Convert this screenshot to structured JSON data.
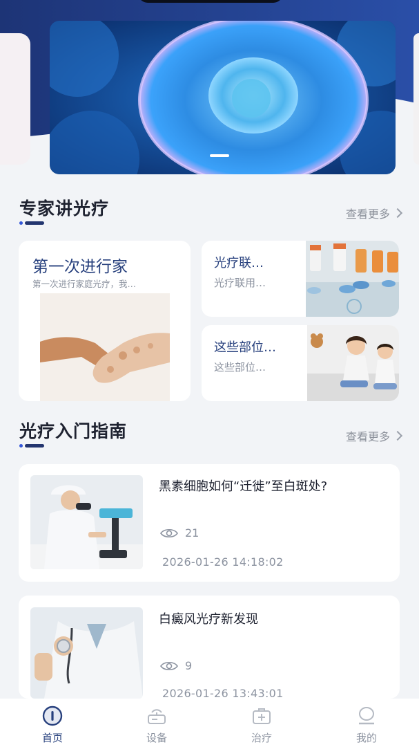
{
  "expert_section": {
    "title": "专家讲光疗",
    "more": "查看更多",
    "cards": [
      {
        "title": "第一次进行家",
        "subtitle": "第一次进行家庭光疗，我…"
      },
      {
        "title": "光疗联…",
        "subtitle": "光疗联用…"
      },
      {
        "title": "这些部位…",
        "subtitle": "这些部位…"
      }
    ]
  },
  "guide_section": {
    "title": "光疗入门指南",
    "more": "查看更多",
    "articles": [
      {
        "title": "黑素细胞如何“迁徙”至白斑处?",
        "views": "21",
        "date": "2026-01-26 14:18:02"
      },
      {
        "title": "白癜风光疗新发现",
        "views": "9",
        "date": "2026-01-26 13:43:01"
      }
    ]
  },
  "tabbar": {
    "items": [
      {
        "label": "首页",
        "icon": "home-icon",
        "active": true
      },
      {
        "label": "设备",
        "icon": "device-icon",
        "active": false
      },
      {
        "label": "治疗",
        "icon": "medical-kit-icon",
        "active": false
      },
      {
        "label": "我的",
        "icon": "profile-icon",
        "active": false
      }
    ]
  },
  "colors": {
    "brand": "#27407d",
    "accent": "#3356d8",
    "background": "#f2f4f7"
  }
}
